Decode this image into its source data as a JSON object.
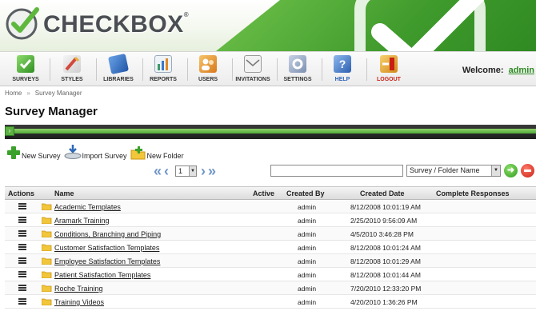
{
  "brand": {
    "name": "CHECKBOX",
    "tm": "®"
  },
  "toolbar": {
    "items": [
      {
        "label": "SURVEYS",
        "icon": "surveys-icon",
        "color": "#3aa12a"
      },
      {
        "label": "STYLES",
        "icon": "styles-icon",
        "color": "#d2483c"
      },
      {
        "label": "LIBRARIES",
        "icon": "libraries-icon",
        "color": "#2d69b8"
      },
      {
        "label": "REPORTS",
        "icon": "reports-icon",
        "color": "#3f9a6a"
      },
      {
        "label": "USERS",
        "icon": "users-icon",
        "color": "#e08a28"
      },
      {
        "label": "INVITATIONS",
        "icon": "invitations-icon",
        "color": "#b9b9b9"
      },
      {
        "label": "SETTINGS",
        "icon": "settings-icon",
        "color": "#7d8fb0"
      },
      {
        "label": "HELP",
        "icon": "help-icon",
        "color": "#3a78c8"
      },
      {
        "label": "LOGOUT",
        "icon": "logout-icon",
        "color": "#e2a52a"
      }
    ],
    "help_label_color": "#2a62b8",
    "logout_label_color": "#c81f13"
  },
  "welcome": {
    "label": "Welcome:",
    "user": "admin"
  },
  "breadcrumb": {
    "home": "Home",
    "current": "Survey Manager"
  },
  "page_title": "Survey Manager",
  "actions": {
    "new_survey": "New Survey",
    "import_survey": "Import Survey",
    "new_folder": "New Folder"
  },
  "pager": {
    "page": "1"
  },
  "search": {
    "query": "",
    "scope": "Survey / Folder Name"
  },
  "table": {
    "headers": {
      "actions": "Actions",
      "name": "Name",
      "active": "Active",
      "created_by": "Created By",
      "created_date": "Created Date",
      "complete": "Complete Responses"
    },
    "rows": [
      {
        "name": "Academic Templates",
        "created_by": "admin",
        "created_date": "8/12/2008 10:01:19 AM"
      },
      {
        "name": "Aramark Training",
        "created_by": "admin",
        "created_date": "2/25/2010 9:56:09 AM"
      },
      {
        "name": "Conditions, Branching and Piping",
        "created_by": "admin",
        "created_date": "4/5/2010 3:46:28 PM"
      },
      {
        "name": "Customer Satisfaction Templates",
        "created_by": "admin",
        "created_date": "8/12/2008 10:01:24 AM"
      },
      {
        "name": "Employee Satisfaction Templates",
        "created_by": "admin",
        "created_date": "8/12/2008 10:01:29 AM"
      },
      {
        "name": "Patient Satisfaction Templates",
        "created_by": "admin",
        "created_date": "8/12/2008 10:01:44 AM"
      },
      {
        "name": "Roche Training",
        "created_by": "admin",
        "created_date": "7/20/2010 12:33:20 PM"
      },
      {
        "name": "Training Videos",
        "created_by": "admin",
        "created_date": "4/20/2010 1:36:26 PM"
      }
    ]
  }
}
